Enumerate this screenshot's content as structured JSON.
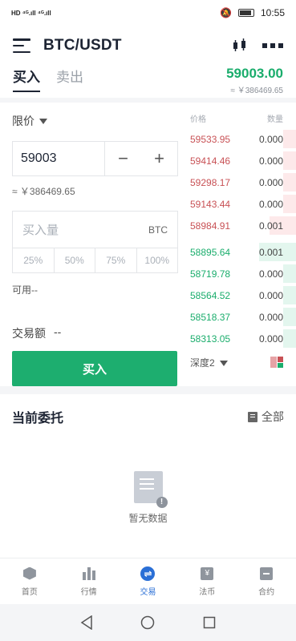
{
  "status_bar": {
    "left": "HD ⁴ᴳ.ıll ⁴ᴳ.ıll",
    "time": "10:55"
  },
  "header": {
    "pair": "BTC/USDT"
  },
  "tabs": [
    {
      "label": "买入",
      "active": true
    },
    {
      "label": "卖出",
      "active": false
    }
  ],
  "ticker": {
    "price": "59003.00",
    "cny": "≈ ￥386469.65"
  },
  "form": {
    "order_type": "限价",
    "price_value": "59003",
    "minus": "−",
    "plus": "+",
    "cny_approx": "≈ ￥386469.65",
    "amount_placeholder": "买入量",
    "amount_unit": "BTC",
    "percents": [
      "25%",
      "50%",
      "75%",
      "100%"
    ],
    "available_label": "可用--",
    "trade_amount_label": "交易额",
    "trade_amount_value": "--",
    "buy_button": "买入"
  },
  "book": {
    "price_header": "价格",
    "qty_header": "数量",
    "asks": [
      {
        "price": "59533.95",
        "qty": "0.000",
        "depth": 0.12
      },
      {
        "price": "59414.46",
        "qty": "0.000",
        "depth": 0.12
      },
      {
        "price": "59298.17",
        "qty": "0.000",
        "depth": 0.12
      },
      {
        "price": "59143.44",
        "qty": "0.000",
        "depth": 0.12
      },
      {
        "price": "58984.91",
        "qty": "0.001",
        "depth": 0.25
      }
    ],
    "bids": [
      {
        "price": "58895.64",
        "qty": "0.001",
        "depth": 0.35
      },
      {
        "price": "58719.78",
        "qty": "0.000",
        "depth": 0.12
      },
      {
        "price": "58564.52",
        "qty": "0.000",
        "depth": 0.12
      },
      {
        "price": "58518.37",
        "qty": "0.000",
        "depth": 0.12
      },
      {
        "price": "58313.05",
        "qty": "0.000",
        "depth": 0.12
      }
    ],
    "depth_label": "深度2"
  },
  "orders": {
    "title": "当前委托",
    "all_label": "全部",
    "empty_text": "暂无数据"
  },
  "tabbar": [
    {
      "label": "首页",
      "icon": "home-icon",
      "active": false
    },
    {
      "label": "行情",
      "icon": "market-icon",
      "active": false
    },
    {
      "label": "交易",
      "icon": "trade-icon",
      "active": true
    },
    {
      "label": "法币",
      "icon": "fiat-icon",
      "active": false
    },
    {
      "label": "合约",
      "icon": "contract-icon",
      "active": false
    }
  ],
  "colors": {
    "buy": "#1dae6f",
    "sell": "#c85155",
    "active_tab": "#2a6fd6"
  }
}
